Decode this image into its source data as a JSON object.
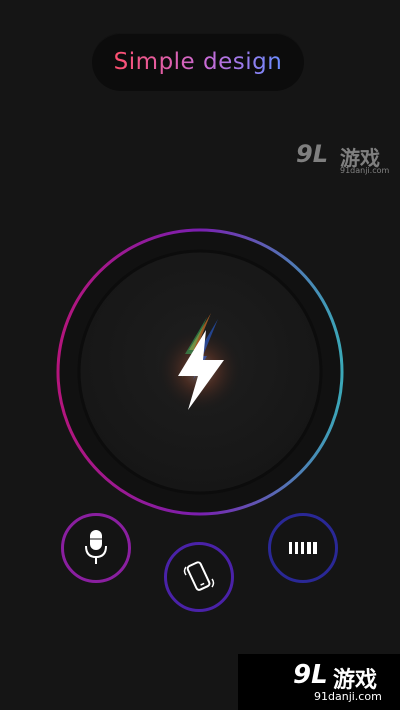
{
  "header": {
    "title": "Simple design"
  },
  "main": {
    "power_icon": "lightning-bolt-icon"
  },
  "controls": [
    {
      "name": "mic",
      "icon": "microphone-icon"
    },
    {
      "name": "shake",
      "icon": "phone-shake-icon"
    },
    {
      "name": "strobe",
      "icon": "strobe-bars-icon"
    }
  ],
  "watermark": {
    "logo": "9L",
    "cn": "游戏",
    "url": "91danji.com"
  },
  "colors": {
    "background": "#151515",
    "ring_pink": "#c2187a",
    "ring_purple": "#7c1fb0",
    "ring_teal": "#3aa6b4",
    "title_start": "#ff4f6e",
    "title_end": "#6a8cff"
  }
}
